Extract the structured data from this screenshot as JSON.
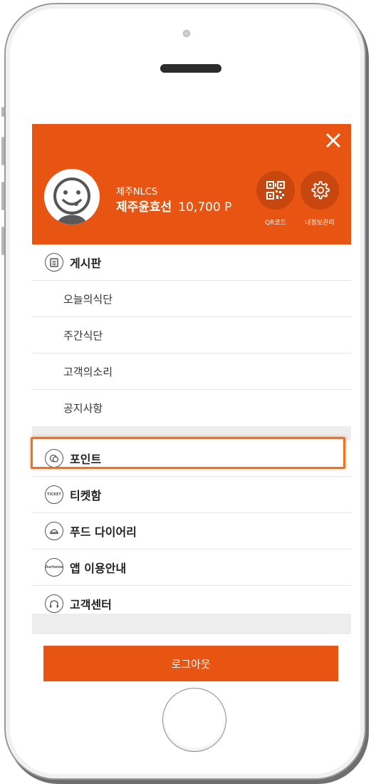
{
  "header": {
    "close_icon": "close-icon",
    "user": {
      "org": "제주NLCS",
      "name": "제주윤효선",
      "points": "10,700 P"
    },
    "qr_button": {
      "label": "QR코드",
      "icon": "qr-code-icon"
    },
    "settings_button": {
      "label": "내정보관리",
      "icon": "gear-icon"
    }
  },
  "menu": {
    "board": {
      "label": "게시판",
      "icon": "clipboard-icon",
      "items": [
        "오늘의식단",
        "주간식단",
        "고객의소리",
        "공지사항"
      ]
    },
    "sections": [
      {
        "label": "포인트",
        "icon": "coin-icon"
      },
      {
        "label": "티켓함",
        "icon": "ticket-icon",
        "icon_text": "TICKET"
      },
      {
        "label": "푸드 다이어리",
        "icon": "food-dome-icon"
      },
      {
        "label": "앱 이용안내",
        "icon": "app-guide-icon",
        "icon_text": "Ourhome"
      },
      {
        "label": "고객센터",
        "icon": "headset-icon"
      }
    ]
  },
  "logout_label": "로그아웃",
  "colors": {
    "accent": "#e85412",
    "highlight": "#f07020",
    "divider": "#e4e4e4",
    "gap": "#ededed"
  }
}
